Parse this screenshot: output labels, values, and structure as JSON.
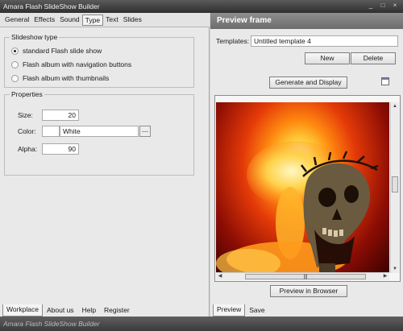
{
  "window": {
    "title": "Amara Flash SlideShow Builder",
    "controls": [
      "_",
      "□",
      "×"
    ]
  },
  "left_tabs": [
    "General",
    "Effects",
    "Sound",
    "Type",
    "Text",
    "Slides"
  ],
  "active_left_tab": "Type",
  "slideshow_type": {
    "legend": "Slideshow type",
    "options": [
      {
        "label": "standard Flash slide show",
        "checked": true
      },
      {
        "label": "Flash album with navigation buttons",
        "checked": false
      },
      {
        "label": "Flash album with thumbnails",
        "checked": false
      }
    ]
  },
  "properties": {
    "legend": "Properties",
    "size_label": "Size:",
    "size_value": "20",
    "color_label": "Color:",
    "color_value": "White",
    "color_swatch": "#ffffff",
    "color_browse": "...",
    "alpha_label": "Alpha:",
    "alpha_value": "90"
  },
  "bottom_left_tabs": [
    "Workplace",
    "About us",
    "Help",
    "Register"
  ],
  "preview": {
    "header": "Preview frame",
    "templates_label": "Templates:",
    "templates_value": "Untitled template 4",
    "new_button": "New",
    "delete_button": "Delete",
    "generate_button": "Generate and Display",
    "browser_button": "Preview in Browser",
    "scroll_thumb_grip": "|||",
    "scroll_arrows": {
      "up": "▲",
      "down": "▼",
      "left": "◀",
      "right": "▶"
    }
  },
  "bottom_right_tabs": [
    "Preview",
    "Save"
  ],
  "status_text": "Amara Flash SlideShow Builder",
  "colors": {
    "panel": "#e9e9e9",
    "titlebar": "#3f3f3f",
    "header": "#7d7d7d",
    "fire": "#e43a08"
  }
}
